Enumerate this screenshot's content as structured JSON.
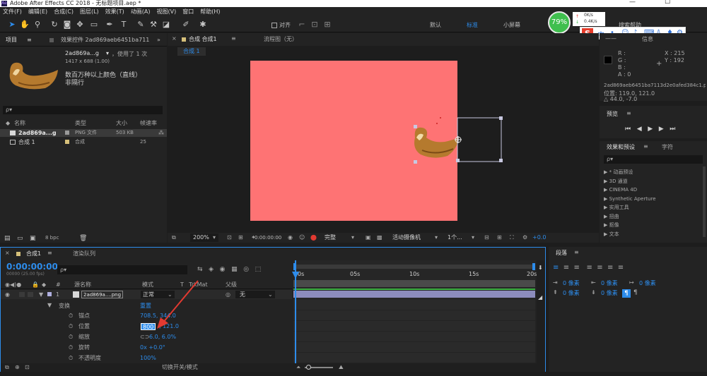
{
  "title_bar": {
    "title": "Adobe After Effects CC 2018 - 无标题项目.aep *",
    "minimize": "—",
    "maximize": "☐"
  },
  "menu": [
    "文件(F)",
    "编辑(E)",
    "合成(C)",
    "图层(L)",
    "效果(T)",
    "动画(A)",
    "视图(V)",
    "窗口",
    "帮助(H)"
  ],
  "toolbar": {
    "snap_label": "对齐",
    "workspaces": [
      "默认",
      "标准",
      "小屏幕"
    ],
    "search_help": "搜索帮助",
    "battery_percent": "79%",
    "net_up": "0K/s",
    "net_down": "0.4K/s",
    "ime_label": "中"
  },
  "project": {
    "tab": "项目",
    "tab_menu": "≡",
    "effect_controls_tab": "效果控件 2ad869aeb6451ba7113",
    "asset_name": "2ad869a...g",
    "asset_used": "，使用了 1 次",
    "asset_dims": "1417 x 688 (1.00)",
    "asset_desc1": "数百万种以上颜色（直线）",
    "asset_desc2": "非隔行",
    "search_placeholder": "ρ▾",
    "columns": [
      "名称",
      "类型",
      "大小",
      "帧速率"
    ],
    "items": [
      {
        "name": "2ad869a...g",
        "type": "PNG 文件",
        "size": "503 KB",
        "fps": ""
      },
      {
        "name": "合成 1",
        "type": "合成",
        "size": "",
        "fps": "25"
      }
    ],
    "bpc": "8 bpc"
  },
  "comp_viewer": {
    "tab": "合成 合成1",
    "tab_menu": "≡",
    "flow_tab": "流程图（无）",
    "subtab": "合成 1",
    "canvas_color": "#fe7374",
    "zoom": "200%",
    "timecode": "0:00:00:00",
    "quality": "完整",
    "camera": "活动摄像机",
    "views": "1个...",
    "exposure": "+0.0"
  },
  "info": {
    "tab": "信息",
    "r": "R :",
    "g": "G :",
    "b": "B :",
    "a": "A : 0",
    "x": "X : 215",
    "y": "Y : 192",
    "file": "2ad869aeb6451ba7113d2e0afed384c1.png",
    "position": "位置: 119.0, 121.0",
    "delta": "△ 44.0, -7.0"
  },
  "preview": {
    "tab": "预览",
    "tab_menu": "≡"
  },
  "effects": {
    "tab": "效果和预设",
    "tab_menu": "≡",
    "char_tab": "字符",
    "search_placeholder": "ρ▾",
    "items": [
      "* 动画预设",
      "3D 通道",
      "CINEMA 4D",
      "Synthetic Aperture",
      "实用工具",
      "扭曲",
      "抠像",
      "文本"
    ]
  },
  "paragraph": {
    "tab": "段落",
    "tab_menu": "≡",
    "indent_values": [
      "0 像素",
      "0 像素",
      "0 像素",
      "0 像素",
      "0 像素"
    ]
  },
  "timeline": {
    "tab": "合成1",
    "tab_menu": "≡",
    "render_tab": "渲染队列",
    "timecode": "0:00:00:00",
    "fps_sub": "00000 (25.00 fps)",
    "search_placeholder": "ρ▾",
    "col_source": "源名称",
    "col_mode": "模式",
    "col_t": "T",
    "col_trkmat": "TrkMat",
    "col_parent": "父级",
    "layer_num": "1",
    "layer_name": "2ad869a....png",
    "layer_mode": "正常",
    "parent_value": "无",
    "transform_label": "变换",
    "reset_label": "重置",
    "props": [
      {
        "name": "锚点",
        "value": "708.5, 344.0"
      },
      {
        "name": "位置",
        "value": "800",
        "value2": ", 121.0"
      },
      {
        "name": "缩放",
        "value": "6.0, 6.0%"
      },
      {
        "name": "旋转",
        "value": "0x +0.0°"
      },
      {
        "name": "不透明度",
        "value": "100%"
      }
    ],
    "ruler": [
      "0s",
      "05s",
      "10s",
      "15s",
      "20s"
    ],
    "toggle_label": "切换开关/模式"
  },
  "colors": {
    "accent": "#2d8ceb",
    "canvas": "#fe7374",
    "annotation_arrow": "#e23a31"
  }
}
